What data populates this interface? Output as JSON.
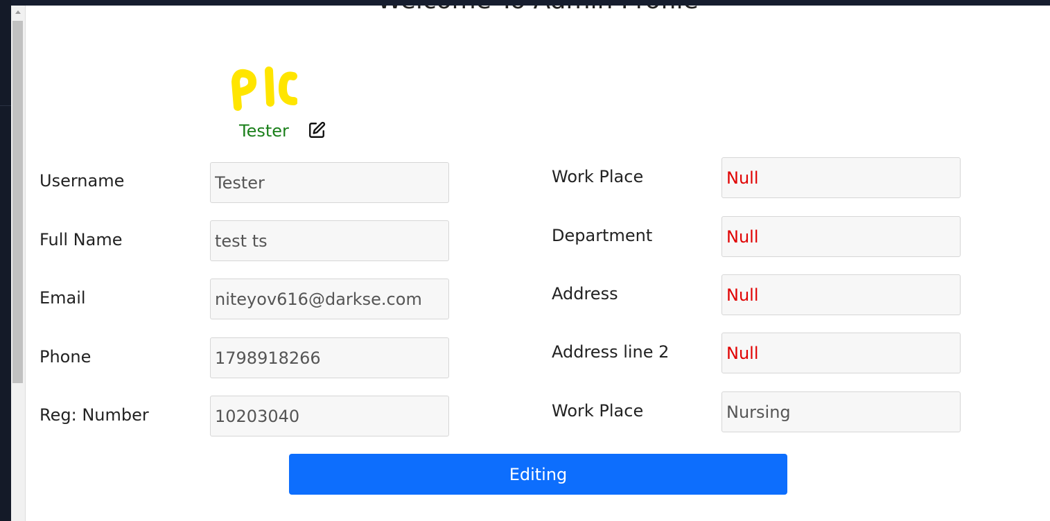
{
  "page": {
    "title": "Welcome To Admin Profile"
  },
  "profile": {
    "picture_text": "PIC",
    "name": "Tester",
    "edit_icon": "edit-square-pencil-icon",
    "name_color": "#1a7f1a"
  },
  "left_fields": [
    {
      "label": "Username",
      "value": "Tester"
    },
    {
      "label": "Full Name",
      "value": "test ts"
    },
    {
      "label": "Email",
      "value": "niteyov616@darkse.com"
    },
    {
      "label": "Phone",
      "value": "1798918266"
    },
    {
      "label": "Reg: Number",
      "value": "10203040"
    }
  ],
  "right_fields": [
    {
      "label": "Work Place",
      "value": "Null"
    },
    {
      "label": "Department",
      "value": "Null"
    },
    {
      "label": "Address",
      "value": "Null"
    },
    {
      "label": "Address line 2",
      "value": "Null"
    },
    {
      "label": "Work Place",
      "value": "Nursing"
    }
  ],
  "submit": {
    "label": "Editing"
  },
  "colors": {
    "accent": "#0d6efd",
    "null_value": "#e00000",
    "picture": "#ffe500"
  }
}
